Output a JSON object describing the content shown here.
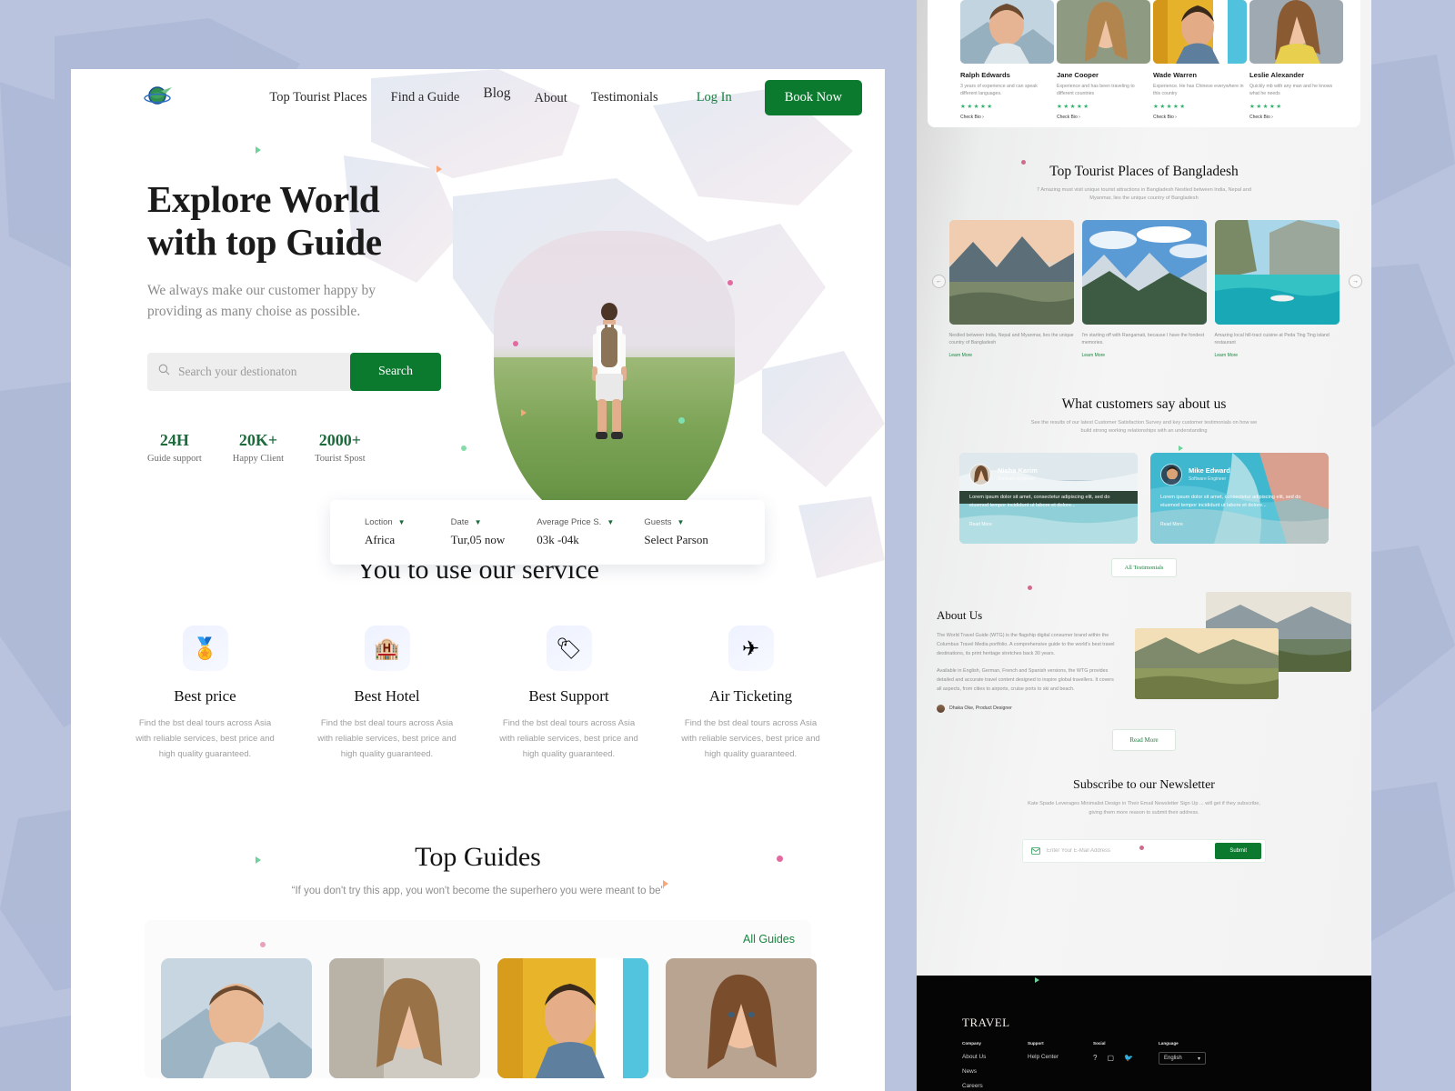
{
  "brand": {
    "logo_icon": "globe-plane-logo",
    "footer_logo": "TRAVEL"
  },
  "nav": {
    "links": [
      {
        "label": "Top Tourist Places"
      },
      {
        "label": "Find a Guide"
      },
      {
        "label": "Blog"
      },
      {
        "label": "About"
      },
      {
        "label": "Testimonials"
      }
    ],
    "login_label": "Log In",
    "book_label": "Book Now"
  },
  "hero": {
    "title_line1": "Explore World",
    "title_line2": "with top Guide",
    "subtitle": "We always make our customer happy by providing as many choise as possible.",
    "search_placeholder": "Search your destionaton",
    "search_value": "",
    "search_button": "Search",
    "search_icon": "search-icon",
    "stats": [
      {
        "value": "24H",
        "label": "Guide support"
      },
      {
        "value": "20K+",
        "label": "Happy Client"
      },
      {
        "value": "2000+",
        "label": "Tourist Spost"
      }
    ]
  },
  "filter_bar": [
    {
      "label": "Loction",
      "value": "Africa"
    },
    {
      "label": "Date",
      "value": "Tur,05 now"
    },
    {
      "label": "Average Price S.",
      "value": "03k -04k"
    },
    {
      "label": "Guests",
      "value": "Select Parson"
    }
  ],
  "services": {
    "title": "You to use our service",
    "items": [
      {
        "icon": "award-icon",
        "glyph": "🏅",
        "name": "Best price",
        "desc": "Find the bst deal tours across Asia with reliable services, best price and high quality guaranteed."
      },
      {
        "icon": "hotel-icon",
        "glyph": "🏨",
        "name": "Best Hotel",
        "desc": "Find the bst deal tours across Asia with reliable services, best price and high quality guaranteed."
      },
      {
        "icon": "support-ticket-icon",
        "glyph": "🏷",
        "name": "Best Support",
        "desc": "Find the bst deal tours across Asia with reliable services, best price and high quality guaranteed."
      },
      {
        "icon": "airplane-icon",
        "glyph": "✈",
        "name": "Air Ticketing",
        "desc": "Find the bst deal tours across Asia with reliable services, best price and high quality guaranteed."
      }
    ]
  },
  "top_guides": {
    "title": "Top Guides",
    "quote": "“If you don't try this app, you won't become the superhero you were meant to be”",
    "all_link": "All Guides",
    "cards": [
      {
        "alt": "male-guide-portrait-mountain"
      },
      {
        "alt": "female-guide-portrait-building"
      },
      {
        "alt": "male-guide-portrait-yellow-wall"
      },
      {
        "alt": "female-guide-portrait-smiling"
      }
    ]
  },
  "guide_cards": [
    {
      "name": "Ralph Edwards",
      "desc": "3 years of experience and can speak different languages.",
      "stars": "★★★★★",
      "link": "Check Bio ›"
    },
    {
      "name": "Jane Cooper",
      "desc": "Experience and has been traveling to different countries",
      "stars": "★★★★★",
      "link": "Check Bio ›"
    },
    {
      "name": "Wade Warren",
      "desc": "Experience. He has Chinese everywhere in this country",
      "stars": "★★★★★",
      "link": "Check Bio ›"
    },
    {
      "name": "Leslie Alexander",
      "desc": "Quickly mb with any man and he knows what he needs",
      "stars": "★★★★★",
      "link": "Check Bio ›"
    }
  ],
  "places": {
    "title": "Top Tourist Places of Bangladesh",
    "subtitle": "7 Amazing must visit unique tourist attractions in Bangladesh Nestled between India, Nepal and Myanmar, lies the unique country of Bangladesh",
    "prev_icon": "arrow-left-icon",
    "next_icon": "arrow-right-icon",
    "items": [
      {
        "desc": "Nestled between India, Nepal and Myanmar, lies the unique country of Bangladesh",
        "link": "Learn More"
      },
      {
        "desc": "I'm starting off with Rangamati, because I have the fondest memories.",
        "link": "Learn More"
      },
      {
        "desc": "Amazing local hill-tract cuisine at Peda Ting Ting island restaurant",
        "link": "Learn More"
      }
    ]
  },
  "testimonials": {
    "title": "What customers say about us",
    "subtitle": "See the results of our latest Customer Satisfaction Survey and key customer testimonials on how we build strong working relationships with an understanding",
    "all_button": "All Testimonials",
    "items": [
      {
        "name": "Nisha Karim",
        "role": "Software Engineer",
        "text": "Lorem ipsum dolor sit amet, consectetur adipiscing elit, sed do eiusmod tempor incididunt ut labore et dolore...",
        "more": "Read More"
      },
      {
        "name": "Mike Edward",
        "role": "Software Engineer",
        "text": "Lorem ipsum dolor sit amet, consectetur adipiscing elit, sed do eiusmod tempor incididunt ut labore et dolore...",
        "more": "Read More"
      }
    ]
  },
  "about": {
    "title": "About Us",
    "p1": "The World Travel Guide (WTG) is the flagship digital consumer brand within the Columbus Travel Media portfolio. A comprehensive guide to the world's best travel destinations, its print heritage stretches back 30 years.",
    "p2": "Available in English, German, French and Spanish versions, the WTG provides detailed and accurate travel content designed to inspire global travellers. It covers all aspects, from cities to airports, cruise ports to ski and beach.",
    "author": "Dhaka Oke, Product Designer",
    "read_more": "Read More"
  },
  "newsletter": {
    "title": "Subscribe to our Newsletter",
    "subtitle": "Kate Spade Leverages Minimalist Design in Their Email Newsletter Sign Up ... will get if they subscribe, giving them more reason to submit their address.",
    "placeholder": "Enter Your E-Mail Address",
    "value": "",
    "mail_icon": "envelope-icon",
    "submit_label": "Submit"
  },
  "footer": {
    "columns": [
      {
        "head": "Company",
        "items": [
          "About Us",
          "News",
          "Careers"
        ]
      },
      {
        "head": "Support",
        "items": [
          "Help Center"
        ]
      }
    ],
    "social_head": "Social",
    "social_icons": [
      "facebook-icon",
      "instagram-icon",
      "twitter-icon"
    ],
    "language_head": "Language",
    "language_value": "English",
    "language_chevron": "chevron-down-icon"
  },
  "colors": {
    "green": "#0b7a2f",
    "green_light": "#1b8440",
    "dark": "#121212",
    "bg": "#b9c3dd"
  }
}
